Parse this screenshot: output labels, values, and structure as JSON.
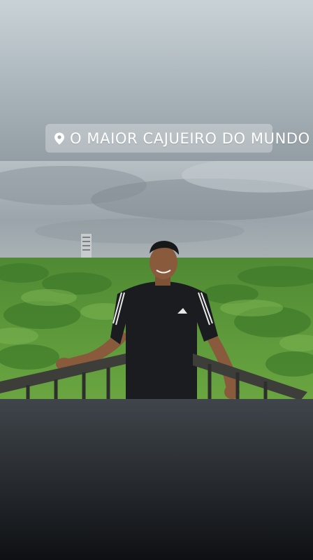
{
  "story": {
    "location_sticker": {
      "text": "O MAIOR CAJUEIRO DO MUNDO",
      "icon": "location-pin-icon"
    },
    "photo": {
      "subject": "person"
    }
  },
  "colors": {
    "sky_top": "#c9d3d7",
    "sky_bottom": "#939da4",
    "dark_bottom": "#0e1013",
    "foliage": "#5f9a3a",
    "shirt": "#1a1c1f"
  }
}
